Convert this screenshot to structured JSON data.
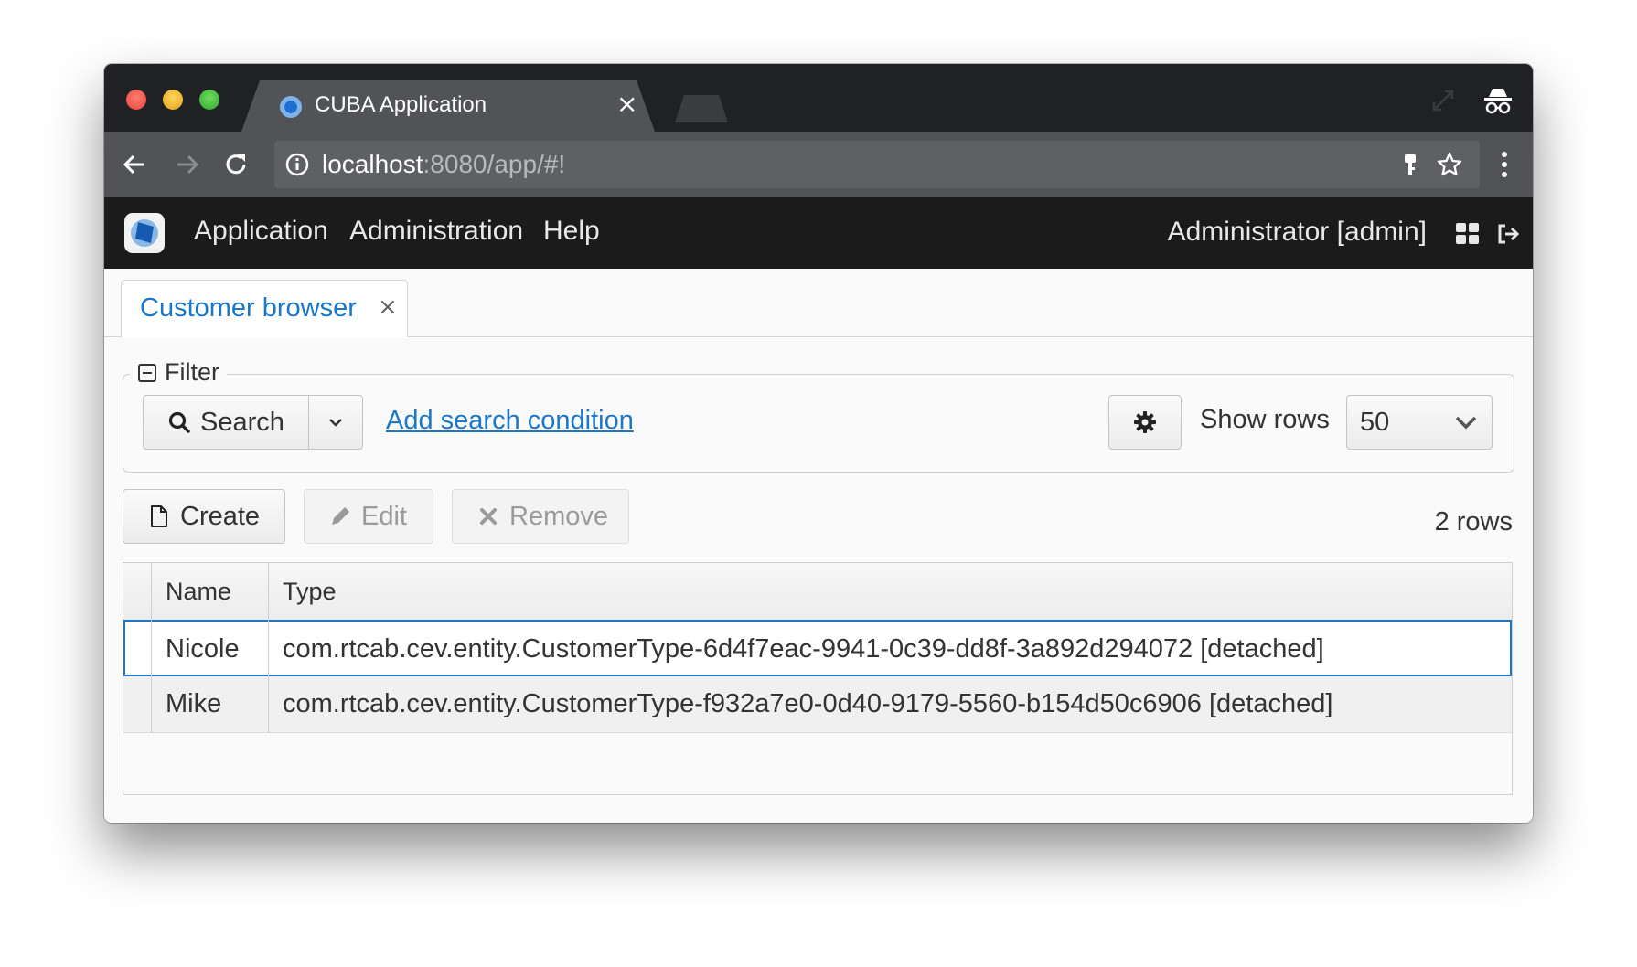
{
  "browser": {
    "tab_title": "CUBA Application",
    "url_host": "localhost",
    "url_rest": ":8080/app/#!"
  },
  "app": {
    "menu": [
      "Application",
      "Administration",
      "Help"
    ],
    "user": "Administrator [admin]"
  },
  "screen_tab": {
    "label": "Customer browser",
    "close": "×"
  },
  "filter": {
    "legend": "Filter",
    "search_label": "Search",
    "add_condition": "Add search condition",
    "show_rows_label": "Show rows",
    "show_rows_value": "50"
  },
  "actions": {
    "create": "Create",
    "edit": "Edit",
    "remove": "Remove",
    "rows_count": "2 rows"
  },
  "table": {
    "columns": [
      "Name",
      "Type"
    ],
    "rows": [
      {
        "name": "Nicole",
        "type": "com.rtcab.cev.entity.CustomerType-6d4f7eac-9941-0c39-dd8f-3a892d294072 [detached]"
      },
      {
        "name": "Mike",
        "type": "com.rtcab.cev.entity.CustomerType-f932a7e0-0d40-9179-5560-b154d50c6906 [detached]"
      }
    ]
  },
  "colors": {
    "accent": "#1c77c9",
    "header_bg": "#1b1b1b",
    "chrome_bg": "#202124"
  },
  "icons": [
    "close-icon",
    "back-arrow-icon",
    "forward-arrow-icon",
    "reload-icon",
    "info-icon",
    "key-icon",
    "star-icon",
    "kebab-menu-icon",
    "restore-window-icon",
    "incognito-icon",
    "cuba-logo-icon",
    "grid-icon",
    "logout-icon",
    "collapse-icon",
    "search-icon",
    "chevron-down-icon",
    "gear-icon",
    "document-icon",
    "pencil-icon",
    "cross-icon"
  ]
}
